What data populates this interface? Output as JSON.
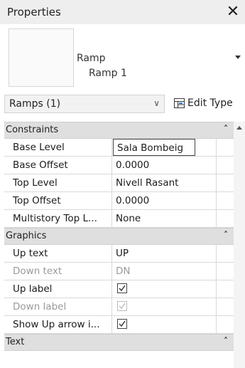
{
  "panel": {
    "title": "Properties",
    "close_glyph": "✕"
  },
  "type_selector": {
    "family": "Ramp",
    "type_name": "Ramp 1"
  },
  "filter": {
    "label": "Ramps (1)",
    "edit_type_label": "Edit Type"
  },
  "sections": {
    "constraints": {
      "label": "Constraints",
      "rows": [
        {
          "name": "Base Level",
          "value": "Sala Bombeig"
        },
        {
          "name": "Base Offset",
          "value": "0.0000"
        },
        {
          "name": "Top Level",
          "value": "Nivell Rasant"
        },
        {
          "name": "Top Offset",
          "value": "0.0000"
        },
        {
          "name": "Multistory Top L...",
          "value": "None"
        }
      ]
    },
    "graphics": {
      "label": "Graphics",
      "rows": [
        {
          "name": "Up text",
          "value": "UP"
        },
        {
          "name": "Down text",
          "value": "DN"
        },
        {
          "name": "Up label",
          "checked": true
        },
        {
          "name": "Down label",
          "checked": true
        },
        {
          "name": "Show Up arrow i...",
          "checked": true
        }
      ]
    },
    "text": {
      "label": "Text"
    }
  },
  "icons": {
    "close": "close-icon",
    "dropdown": "chevron-down-icon",
    "edit_type": "edit-type-icon",
    "collapse": "collapse-section-icon",
    "scroll_up": "scroll-up-icon"
  }
}
